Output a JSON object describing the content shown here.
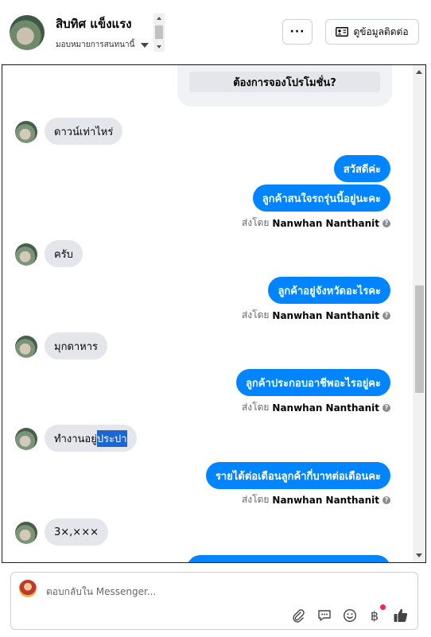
{
  "header": {
    "contact_name": "สิบทิศ แข็งแรง",
    "assign_label": "มอบหมายการสนทนานี้",
    "more_label": "···",
    "view_contact_label": "ดูข้อมูลติดต่อ"
  },
  "promo_button": "ต้องการจองโปรโมชั่น?",
  "messages": [
    {
      "dir": "in",
      "text": "ดาวน์เท่าไหร่"
    },
    {
      "dir": "out",
      "text": "สวัสดีค่ะ"
    },
    {
      "dir": "out",
      "text": "ลูกค้าสนใจรถรุ่นนี้อยู่นะคะ"
    },
    {
      "dir": "in",
      "text": "ครับ"
    },
    {
      "dir": "out",
      "text": "ลูกค้าอยู่จังหวัดอะไรคะ"
    },
    {
      "dir": "in",
      "text": "มุกดาหาร"
    },
    {
      "dir": "out",
      "text": "ลูกค้าประกอบอาชีพอะไรอยู่คะ"
    },
    {
      "dir": "in",
      "text_before": "ทำงานอยู่",
      "text_selected": "ประปา"
    },
    {
      "dir": "out",
      "text": "รายได้ต่อเดือนลูกค้ากี่บาทต่อเดือนคะ"
    },
    {
      "dir": "in",
      "text": "3×,×××"
    }
  ],
  "sent_by": {
    "prefix": "ส่งโดย",
    "name": "Nanwhan Nanthanit"
  },
  "compose": {
    "placeholder": "ตอบกลับใน Messenger..."
  },
  "icons": {
    "attach": "paperclip-icon",
    "saved_replies": "speech-bubble-icon",
    "emoji": "smiley-icon",
    "payment": "baht-icon",
    "like": "thumbs-up-icon"
  },
  "colors": {
    "outgoing_bubble": "#0084ff",
    "incoming_bubble": "#e4e6eb",
    "notification_dot": "#f02849",
    "selection": "#1a66d2"
  }
}
